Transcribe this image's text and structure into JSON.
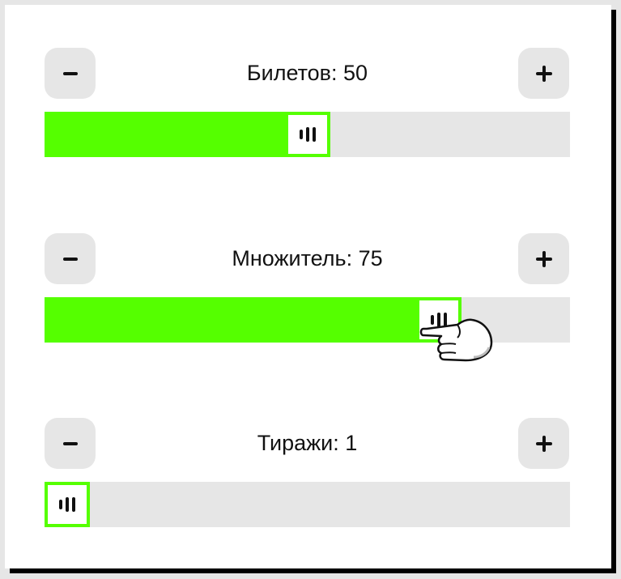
{
  "colors": {
    "accent": "#55ff00",
    "track": "#e6e6e6",
    "button": "#e6e6e6",
    "text": "#111111"
  },
  "controls": [
    {
      "label": "Билетов: 50",
      "minus_icon": "minus-icon",
      "plus_icon": "plus-icon",
      "slider_fraction": 0.5
    },
    {
      "label": "Множитель: 75",
      "minus_icon": "minus-icon",
      "plus_icon": "plus-icon",
      "slider_fraction": 0.75
    },
    {
      "label": "Тиражи: 1",
      "minus_icon": "minus-icon",
      "plus_icon": "plus-icon",
      "slider_fraction": 0.0
    }
  ],
  "cursor_icon": "hand-pointer-icon"
}
